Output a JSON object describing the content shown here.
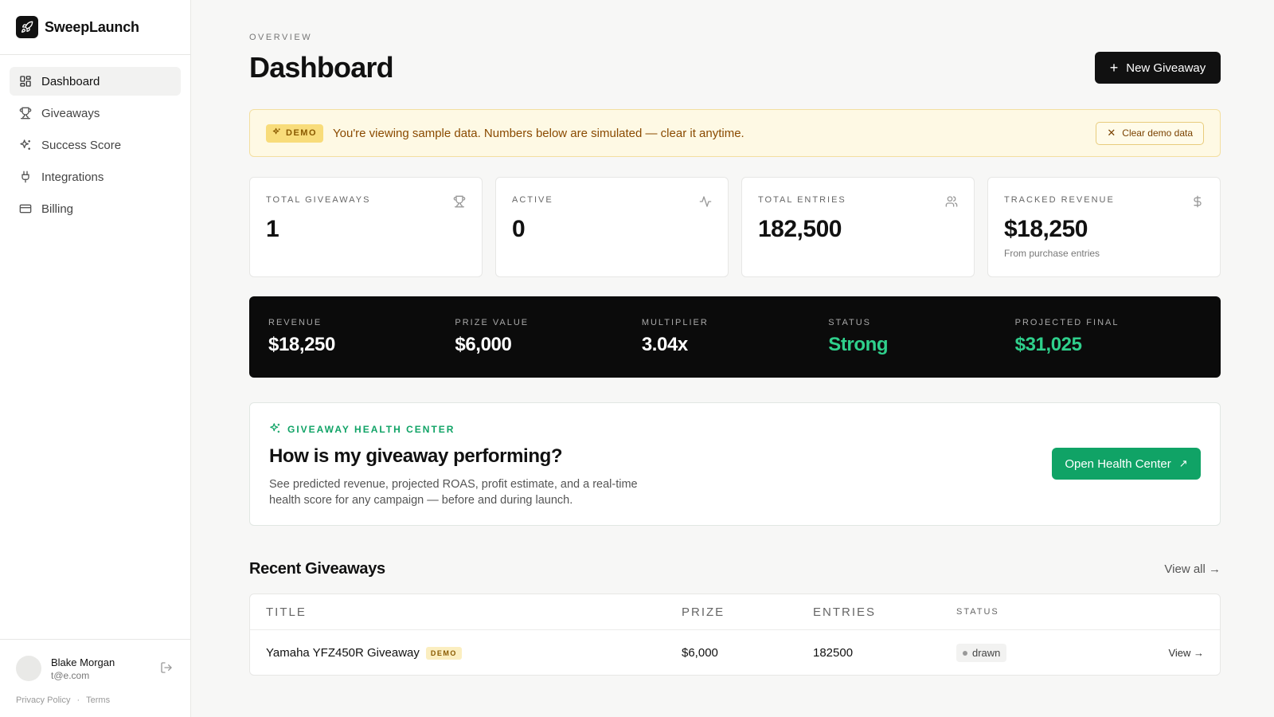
{
  "brand": {
    "name": "SweepLaunch",
    "logo_icon": "rocket-icon"
  },
  "sidebar": {
    "items": [
      {
        "label": "Dashboard",
        "icon": "dashboard-icon",
        "active": true
      },
      {
        "label": "Giveaways",
        "icon": "trophy-icon",
        "active": false
      },
      {
        "label": "Success Score",
        "icon": "sparkles-icon",
        "active": false
      },
      {
        "label": "Integrations",
        "icon": "plug-icon",
        "active": false
      },
      {
        "label": "Billing",
        "icon": "credit-card-icon",
        "active": false
      }
    ],
    "user": {
      "name": "Blake Morgan",
      "email": "t@e.com"
    },
    "legal": {
      "privacy": "Privacy Policy",
      "separator": "·",
      "terms": "Terms"
    }
  },
  "header": {
    "eyebrow": "OVERVIEW",
    "title": "Dashboard",
    "new_button": "New Giveaway"
  },
  "demo_banner": {
    "badge": "DEMO",
    "message": "You're viewing sample data. Numbers below are simulated — clear it anytime.",
    "clear_button": "Clear demo data"
  },
  "stats": [
    {
      "label": "TOTAL GIVEAWAYS",
      "value": "1",
      "sub": "",
      "icon": "trophy-icon"
    },
    {
      "label": "ACTIVE",
      "value": "0",
      "sub": "",
      "icon": "activity-icon"
    },
    {
      "label": "TOTAL ENTRIES",
      "value": "182,500",
      "sub": "",
      "icon": "users-icon"
    },
    {
      "label": "TRACKED REVENUE",
      "value": "$18,250",
      "sub": "From purchase entries",
      "icon": "dollar-icon"
    }
  ],
  "summary": [
    {
      "label": "REVENUE",
      "value": "$18,250",
      "highlight": false
    },
    {
      "label": "PRIZE VALUE",
      "value": "$6,000",
      "highlight": false
    },
    {
      "label": "MULTIPLIER",
      "value": "3.04x",
      "highlight": false
    },
    {
      "label": "STATUS",
      "value": "Strong",
      "highlight": true
    },
    {
      "label": "PROJECTED FINAL",
      "value": "$31,025",
      "highlight": true
    }
  ],
  "health": {
    "eyebrow": "GIVEAWAY HEALTH CENTER",
    "title": "How is my giveaway performing?",
    "description": "See predicted revenue, projected ROAS, profit estimate, and a real-time health score for any campaign — before and during launch.",
    "button": "Open Health Center"
  },
  "recent": {
    "title": "Recent Giveaways",
    "view_all": "View all →",
    "columns": [
      "TITLE",
      "PRIZE",
      "ENTRIES",
      "STATUS"
    ],
    "rows": [
      {
        "title": "Yamaha YFZ450R Giveaway",
        "badge": "DEMO",
        "prize": "$6,000",
        "entries": "182500",
        "status": "drawn",
        "action": "View →"
      }
    ]
  },
  "colors": {
    "accent_green": "#10a366",
    "highlight_green": "#2fd08c",
    "demo_yellow": "#f8dc7a",
    "dark": "#0b0b0b"
  }
}
